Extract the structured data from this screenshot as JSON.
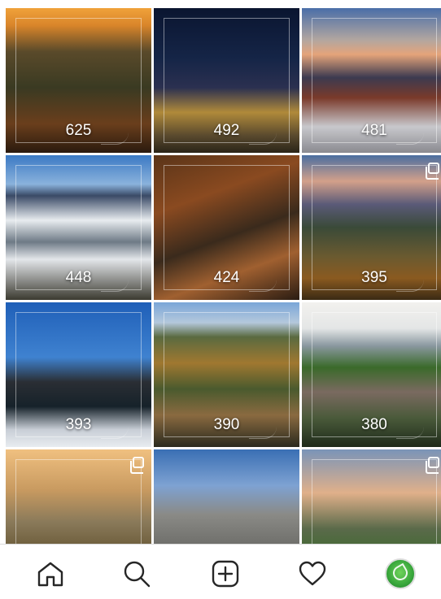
{
  "grid": {
    "tiles": [
      {
        "count": "625",
        "multiple": false,
        "bg": "linear-gradient(180deg,#f0a23a 0%,#d9852a 12%,#5a4a2a 30%,#3a3a22 55%,#6a3e1c 80%,#2a1a0e 100%)"
      },
      {
        "count": "492",
        "multiple": false,
        "bg": "linear-gradient(180deg,#0a1530 0%,#152547 35%,#2b3050 55%,#b08a3a 72%,#5a4a2e 88%,#2a2418 100%)"
      },
      {
        "count": "481",
        "multiple": false,
        "bg": "linear-gradient(180deg,#4a6ea8 0%,#b2a6a0 22%,#e5a47a 32%,#3c3a50 48%,#7a3a2a 62%,#c8c8cc 82%,#8a8a90 100%)"
      },
      {
        "count": "448",
        "multiple": false,
        "bg": "linear-gradient(180deg,#3b79c4 0%,#8ab2dc 20%,#3a4a66 28%,#e8ecef 45%,#6e7a86 60%,#e3e6ea 72%,#3b3a30 100%)"
      },
      {
        "count": "424",
        "multiple": false,
        "bg": "linear-gradient(160deg,#5a3418 0%,#8a4a20 30%,#3a2a1c 55%,#a06030 75%,#2a1c12 100%)"
      },
      {
        "count": "395",
        "multiple": true,
        "bg": "linear-gradient(180deg,#4a6ea0 0%,#d3a08a 18%,#5a5a78 34%,#3a4a38 50%,#6a5a30 70%,#8a5a20 85%,#3a2a14 100%)"
      },
      {
        "count": "393",
        "multiple": false,
        "bg": "linear-gradient(180deg,#1f5fb8 0%,#3f82d0 38%,#2a2e34 55%,#16222a 72%,#c8ced6 88%,#e8ecf0 100%)"
      },
      {
        "count": "390",
        "multiple": false,
        "bg": "linear-gradient(180deg,#7aa6d8 0%,#b4c8dc 14%,#5a6a40 24%,#a07830 42%,#4a5a2e 60%,#8a6a40 78%,#2a2a1e 100%)"
      },
      {
        "count": "380",
        "multiple": false,
        "bg": "linear-gradient(180deg,#f2f1ee 0%,#e4e6e6 18%,#8a98a0 30%,#3a6a2a 45%,#7a6a60 62%,#4a5a3a 80%,#1e2a1a 100%)"
      },
      {
        "count": "",
        "multiple": true,
        "bg": "linear-gradient(180deg,#f0c080 0%,#c89a60 28%,#8a7a5a 50%,#6a5a38 70%,#a05a20 100%)"
      },
      {
        "count": "",
        "multiple": false,
        "bg": "linear-gradient(180deg,#3a6fb4 0%,#7ea2d2 25%,#8a8a86 45%,#6a6a66 70%,#4a4a46 100%)"
      },
      {
        "count": "",
        "multiple": true,
        "bg": "linear-gradient(180deg,#7a94b8 0%,#e0b08a 30%,#5a6a4a 55%,#3e6a2e 75%,#2a4a20 100%)"
      }
    ]
  },
  "nav": {
    "items": [
      {
        "name": "home-icon"
      },
      {
        "name": "search-icon"
      },
      {
        "name": "add-post-icon"
      },
      {
        "name": "activity-heart-icon"
      },
      {
        "name": "profile-avatar"
      }
    ],
    "accent": "#38a63b"
  }
}
